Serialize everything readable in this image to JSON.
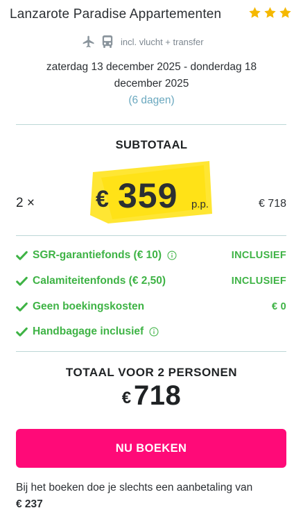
{
  "header": {
    "title": "Lanzarote Paradise Appartementen",
    "star_rating": 3,
    "star_color": "#f5b800"
  },
  "transport": {
    "icons": [
      "plane-icon",
      "bus-icon"
    ],
    "label": "incl. vlucht + transfer"
  },
  "dates": {
    "range_line1": "zaterdag 13 december 2025 - donderdag 18",
    "range_line2": "december 2025",
    "duration": "(6 dagen)"
  },
  "subtotal": {
    "heading": "SUBTOTAAL",
    "quantity": "2 ×",
    "currency": "€",
    "price_per_person": "359",
    "per_person_label": "p.p.",
    "row_total": "€ 718",
    "highlight_color": "#ffe633"
  },
  "features": [
    {
      "label": "SGR-garantiefonds  (€ 10)",
      "info": true,
      "value": "INCLUSIEF"
    },
    {
      "label": "Calamiteitenfonds  (€ 2,50)",
      "info": false,
      "value": "INCLUSIEF"
    },
    {
      "label": "Geen boekingskosten",
      "info": false,
      "value": "€ 0"
    },
    {
      "label": "Handbagage inclusief",
      "info": true,
      "value": ""
    }
  ],
  "total": {
    "heading": "TOTAAL VOOR 2 PERSONEN",
    "currency": "€",
    "amount": "718"
  },
  "booking": {
    "button_label": "NU BOEKEN",
    "button_color": "#ff0a78",
    "deposit_text": "Bij het boeken doe je slechts een aanbetaling van",
    "deposit_amount": "€ 237"
  },
  "colors": {
    "accent_green": "#3eb345",
    "duration_blue": "#6aa8bf",
    "divider": "#bcd7d6"
  }
}
